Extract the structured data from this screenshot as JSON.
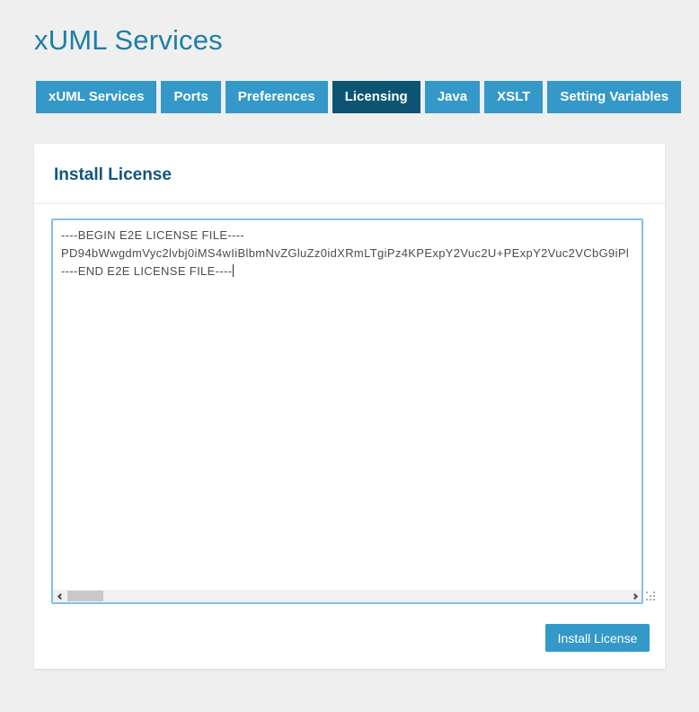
{
  "page": {
    "title": "xUML Services",
    "background_color": "#efefef"
  },
  "tabs": [
    {
      "label": "xUML Services",
      "active": false
    },
    {
      "label": "Ports",
      "active": false
    },
    {
      "label": "Preferences",
      "active": false
    },
    {
      "label": "Licensing",
      "active": true
    },
    {
      "label": "Java",
      "active": false
    },
    {
      "label": "XSLT",
      "active": false
    },
    {
      "label": "Setting Variables",
      "active": false
    }
  ],
  "panel": {
    "heading": "Install License",
    "button_label": "Install License"
  },
  "license": {
    "lines": [
      "----BEGIN E2E LICENSE FILE----",
      "PD94bWwgdmVyc2lvbj0iMS4wIiBlbmNvZGluZz0idXRmLTgiPz4KPExpY2Vuc2U+PExpY2Vuc2VCbG9iPl",
      "----END E2E LICENSE FILE----"
    ],
    "cursor_visible": true
  },
  "scrollbar": {
    "left_icon": "chevron-left",
    "right_icon": "chevron-right",
    "resize_icon": "resize-grip"
  },
  "colors": {
    "tab": "#3498c8",
    "tab_active": "#0d5473",
    "title_text": "#1e7ea6",
    "heading_text": "#13567d",
    "button": "#3498c8",
    "textarea_border": "#85bfe7",
    "textarea_text": "#4d4d4d"
  }
}
